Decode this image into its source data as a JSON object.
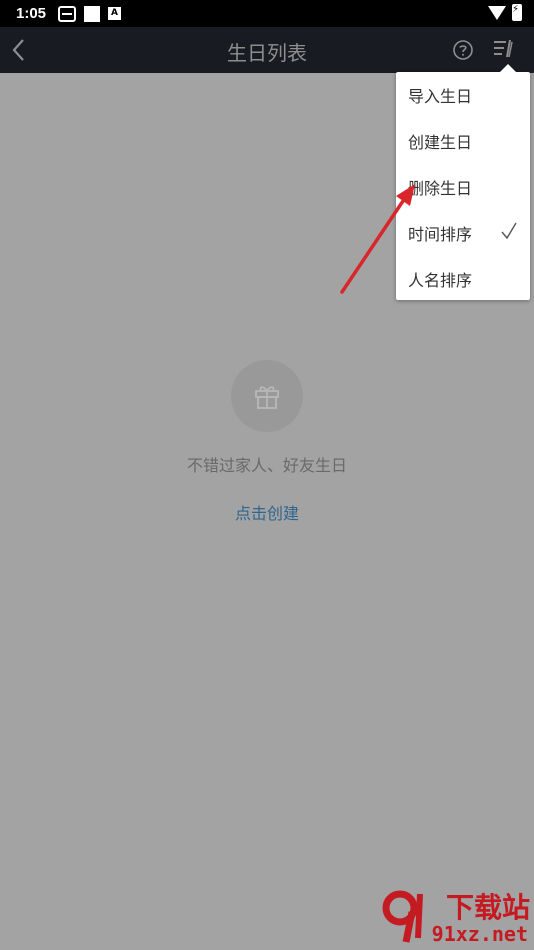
{
  "status_bar": {
    "time": "1:05",
    "icons": [
      "sim-icon",
      "square-icon",
      "a-icon",
      "wifi-icon",
      "battery-icon"
    ],
    "a_icon_text": "A"
  },
  "nav": {
    "title": "生日列表",
    "icons": [
      "back-icon",
      "help-icon",
      "menu-icon"
    ]
  },
  "empty_state": {
    "icon": "gift-icon",
    "text": "不错过家人、好友生日",
    "link": "点击创建"
  },
  "dropdown": {
    "items": [
      {
        "label": "导入生日",
        "checked": false
      },
      {
        "label": "创建生日",
        "checked": false
      },
      {
        "label": "删除生日",
        "checked": false
      },
      {
        "label": "时间排序",
        "checked": true
      },
      {
        "label": "人名排序",
        "checked": false
      }
    ]
  },
  "watermark": {
    "top": "下载站",
    "bottom": "91xz.net"
  },
  "colors": {
    "nav_bg": "#181b22",
    "overlay_bg": "#a3a3a3",
    "link": "#2f6690",
    "arrow": "#d9262b"
  }
}
